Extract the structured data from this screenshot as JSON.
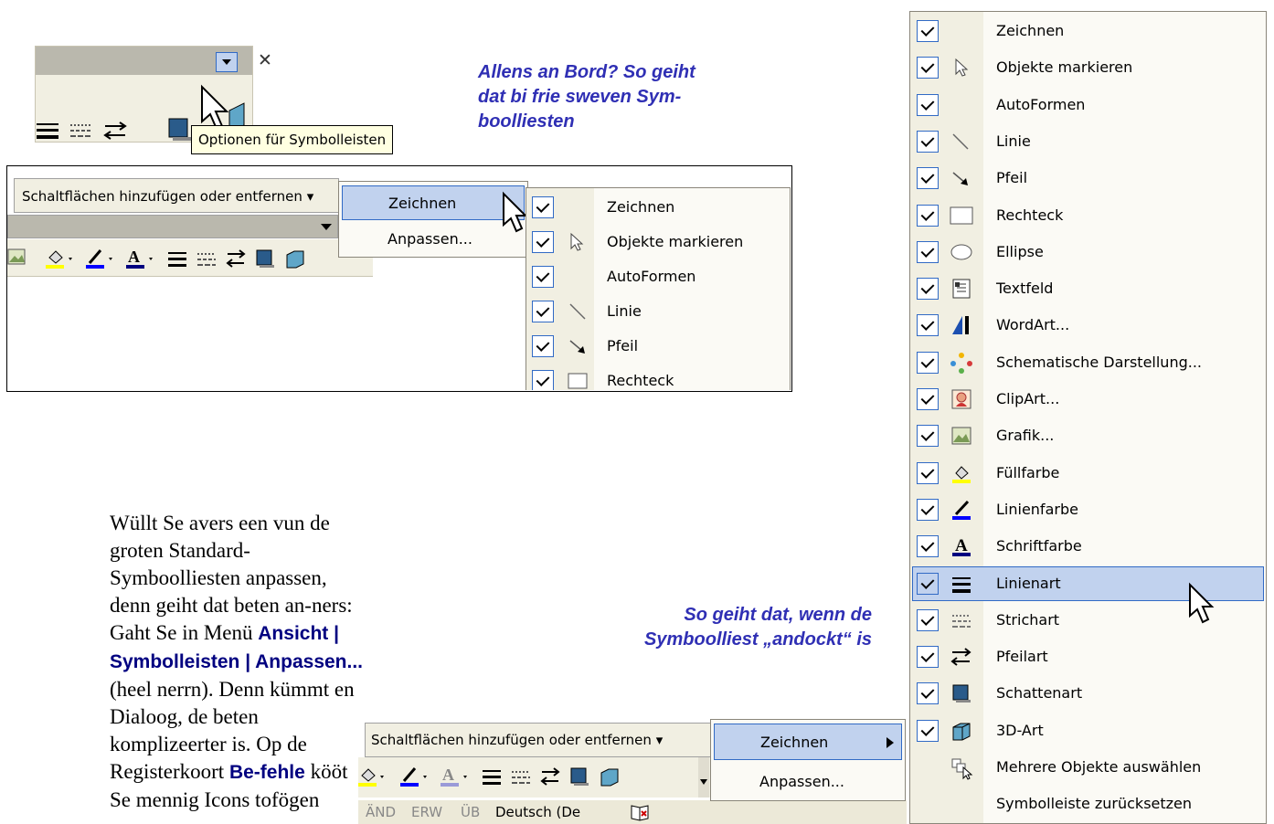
{
  "floating": {
    "tooltip": "Optionen für Symbolleisten"
  },
  "captions": {
    "top": [
      "Allens an Bord? So geiht",
      "dat bi frie sweven Sym-",
      "boolliesten"
    ],
    "docked": [
      "So geiht dat, wenn de",
      "Symboolliest „andockt“ is"
    ]
  },
  "mid": {
    "add_remove_label": "Schaltflächen hinzufügen oder entfernen ▾",
    "submenu": [
      {
        "label": "Zeichnen",
        "highlighted": true,
        "has_arrow": true
      },
      {
        "label": "Anpassen..."
      }
    ],
    "items": [
      "Zeichnen",
      "Objekte markieren",
      "AutoFormen",
      "Linie",
      "Pfeil",
      "Rechteck"
    ]
  },
  "body_text": {
    "p1": "Wüllt Se avers een vun de groten Standard-Symboolliesten anpassen, denn geiht dat beten an-ners: Gaht Se in Menü",
    "menu_path": "Ansicht | Symbolleisten | Anpassen...",
    "p2": "(heel nerrn). Denn kümmt en Dialoog, de beten komplizeerter is. Op de Registerkoort",
    "tab_name": "Be-fehle",
    "p3": "kööt Se mennig Icons tofögen"
  },
  "docked": {
    "add_remove_label": "Schaltflächen hinzufügen oder entfernen ▾",
    "submenu": [
      {
        "label": "Zeichnen",
        "highlighted": true,
        "has_arrow": true
      },
      {
        "label": "Anpassen..."
      }
    ],
    "status": [
      "ÄND",
      "ERW",
      "ÜB",
      "Deutsch (De"
    ]
  },
  "big_menu": {
    "items": [
      {
        "label": "Zeichnen",
        "checked": true,
        "icon": "none"
      },
      {
        "label": "Objekte markieren",
        "checked": true,
        "icon": "pointer-icon"
      },
      {
        "label": "AutoFormen",
        "checked": true,
        "icon": "none"
      },
      {
        "label": "Linie",
        "checked": true,
        "icon": "line-icon"
      },
      {
        "label": "Pfeil",
        "checked": true,
        "icon": "arrow-icon"
      },
      {
        "label": "Rechteck",
        "checked": true,
        "icon": "rectangle-icon"
      },
      {
        "label": "Ellipse",
        "checked": true,
        "icon": "ellipse-icon"
      },
      {
        "label": "Textfeld",
        "checked": true,
        "icon": "textbox-icon"
      },
      {
        "label": "WordArt...",
        "checked": true,
        "icon": "wordart-icon"
      },
      {
        "label": "Schematische Darstellung...",
        "checked": true,
        "icon": "diagram-icon"
      },
      {
        "label": "ClipArt...",
        "checked": true,
        "icon": "clipart-icon"
      },
      {
        "label": "Grafik...",
        "checked": true,
        "icon": "picture-icon"
      },
      {
        "label": "Füllfarbe",
        "checked": true,
        "icon": "fill-color-icon"
      },
      {
        "label": "Linienfarbe",
        "checked": true,
        "icon": "line-color-icon"
      },
      {
        "label": "Schriftfarbe",
        "checked": true,
        "icon": "font-color-icon"
      },
      {
        "label": "Linienart",
        "checked": true,
        "icon": "line-style-icon",
        "highlighted": true
      },
      {
        "label": "Strichart",
        "checked": true,
        "icon": "dash-style-icon"
      },
      {
        "label": "Pfeilart",
        "checked": true,
        "icon": "arrow-style-icon"
      },
      {
        "label": "Schattenart",
        "checked": true,
        "icon": "shadow-icon"
      },
      {
        "label": "3D-Art",
        "checked": true,
        "icon": "3d-icon"
      },
      {
        "label": "Mehrere Objekte auswählen",
        "checked": false,
        "icon": "multi-select-icon"
      },
      {
        "label": "Symbolleiste zurücksetzen",
        "checked": false,
        "icon": "none"
      }
    ]
  },
  "colors": {
    "highlight": "#c1d2ee",
    "highlight_border": "#316ac5",
    "caption": "#2f2fb4",
    "menu_bg": "#fbfaf5",
    "toolbar_bg": "#f1efe2"
  }
}
